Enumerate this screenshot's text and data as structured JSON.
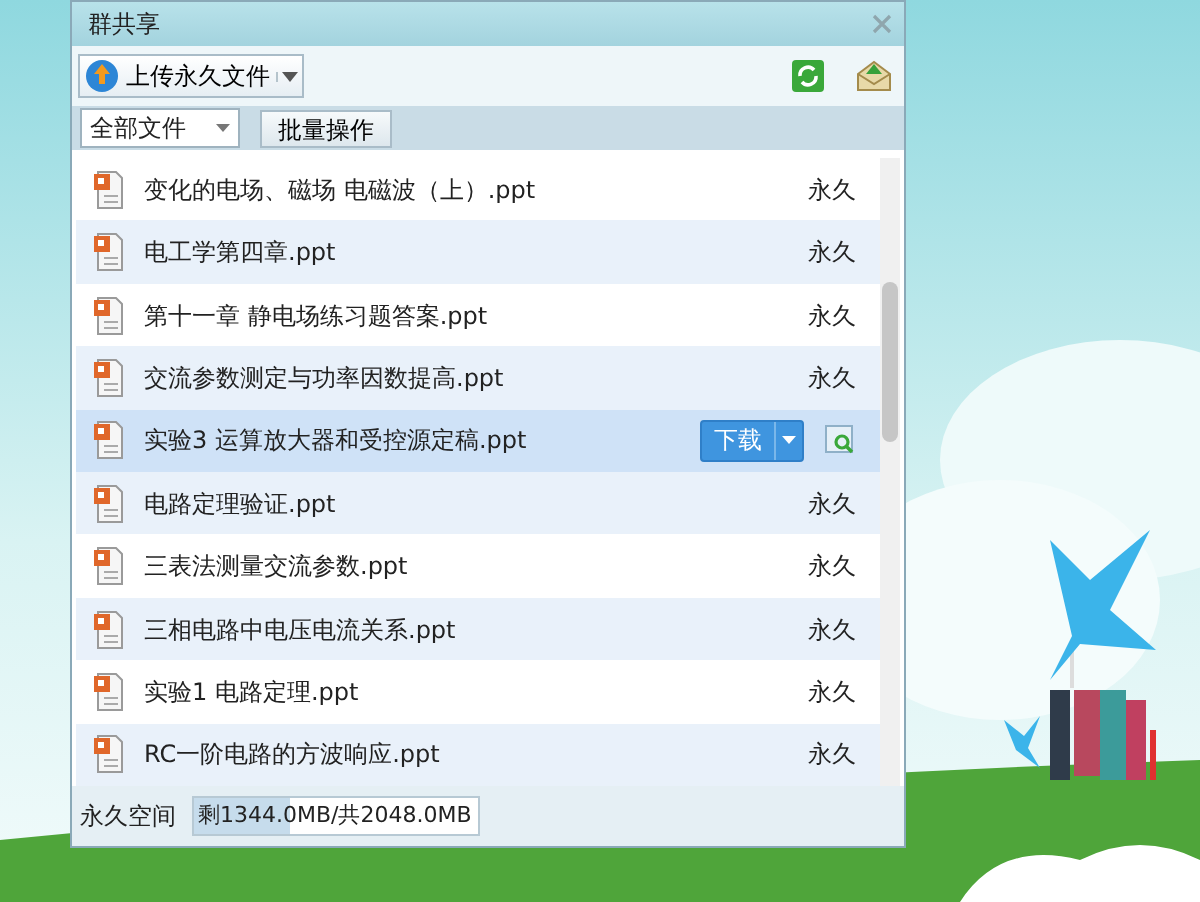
{
  "window": {
    "title": "群共享"
  },
  "toolbar": {
    "upload_button": "上传永久文件"
  },
  "filter": {
    "dropdown_value": "全部文件",
    "batch_button": "批量操作"
  },
  "files": [
    {
      "name": "变化的电场、磁场 电磁波（上）.ppt",
      "status": "永久",
      "selected": false
    },
    {
      "name": "电工学第四章.ppt",
      "status": "永久",
      "selected": false
    },
    {
      "name": "第十一章 静电场练习题答案.ppt",
      "status": "永久",
      "selected": false
    },
    {
      "name": "交流参数测定与功率因数提高.ppt",
      "status": "永久",
      "selected": false
    },
    {
      "name": "实验3 运算放大器和受控源定稿.ppt",
      "download": "下载",
      "selected": true
    },
    {
      "name": "电路定理验证.ppt",
      "status": "永久",
      "selected": false
    },
    {
      "name": "三表法测量交流参数.ppt",
      "status": "永久",
      "selected": false
    },
    {
      "name": "三相电路中电压电流关系.ppt",
      "status": "永久",
      "selected": false
    },
    {
      "name": "实验1 电路定理.ppt",
      "status": "永久",
      "selected": false
    },
    {
      "name": "RC一阶电路的方波响应.ppt",
      "status": "永久",
      "selected": false
    }
  ],
  "footer": {
    "label": "永久空间",
    "usage": "剩1344.0MB/共2048.0MB",
    "level": 0.34
  }
}
